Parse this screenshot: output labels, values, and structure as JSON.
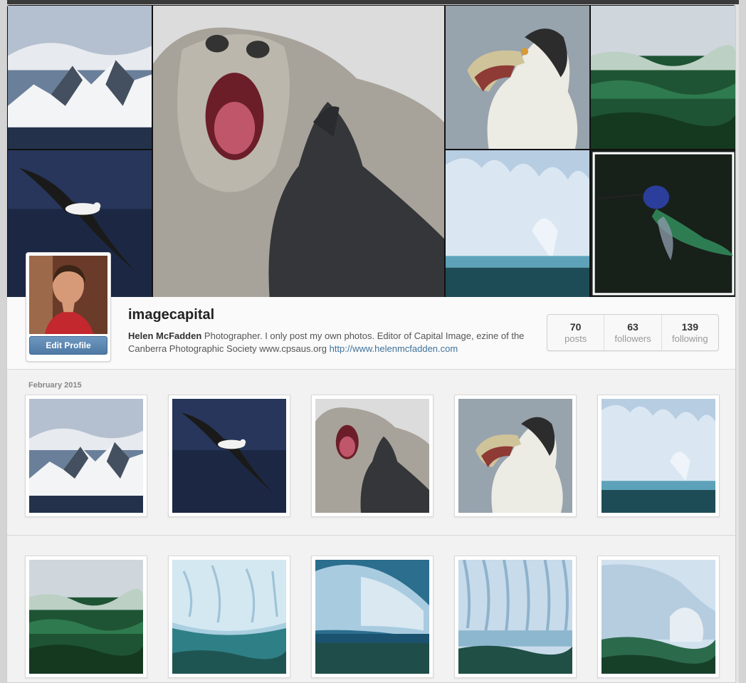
{
  "profile": {
    "username": "imagecapital",
    "full_name": "Helen McFadden",
    "bio": "Photographer. I only post my own photos. Editor of Capital Image, ezine of the Canberra Photographic Society www.cpsaus.org",
    "website": "http://www.helenmcfadden.com",
    "edit_label": "Edit Profile"
  },
  "stats": [
    {
      "value": "70",
      "label": "posts"
    },
    {
      "value": "63",
      "label": "followers"
    },
    {
      "value": "139",
      "label": "following"
    }
  ],
  "feed": {
    "month_label": "February 2015",
    "row1": [
      "mountain-photo",
      "albatross-photo",
      "seal-photo",
      "chick-photo",
      "iceberg-photo"
    ],
    "row2": [
      "wave-photo",
      "ice-cave-photo",
      "ice-wall-photo",
      "ice-texture-photo",
      "ice-splash-photo"
    ]
  },
  "cover": [
    "mountain-photo",
    "albatross-photo",
    "seal-photo",
    "chick-photo",
    "wave-photo",
    "iceberg-photo",
    "hummingbird-photo"
  ],
  "colors": {
    "link": "#3f729b",
    "button": "#517fa4",
    "ocean": "#1f5a3a",
    "ice": "#cfe0ee"
  }
}
